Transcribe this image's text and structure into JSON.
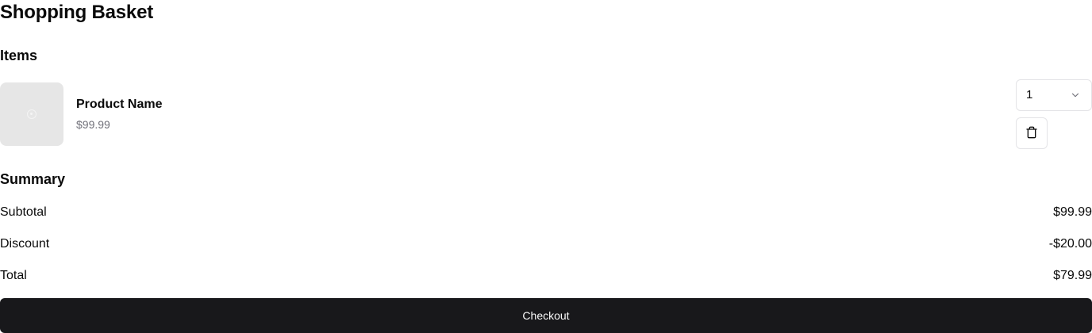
{
  "page": {
    "title": "Shopping Basket"
  },
  "items_section": {
    "title": "Items",
    "items": [
      {
        "name": "Product Name",
        "price": "$99.99",
        "quantity": "1",
        "image_icon": "image-placeholder-icon",
        "delete_icon": "trash-icon"
      }
    ]
  },
  "summary": {
    "title": "Summary",
    "subtotal_label": "Subtotal",
    "subtotal_value": "$99.99",
    "discount_label": "Discount",
    "discount_value": "-$20.00",
    "total_label": "Total",
    "total_value": "$79.99"
  },
  "checkout": {
    "label": "Checkout"
  },
  "colors": {
    "accent": "#18181b",
    "muted_text": "#71717a",
    "border": "#e4e4e7",
    "placeholder_bg": "#e6e6e6"
  }
}
